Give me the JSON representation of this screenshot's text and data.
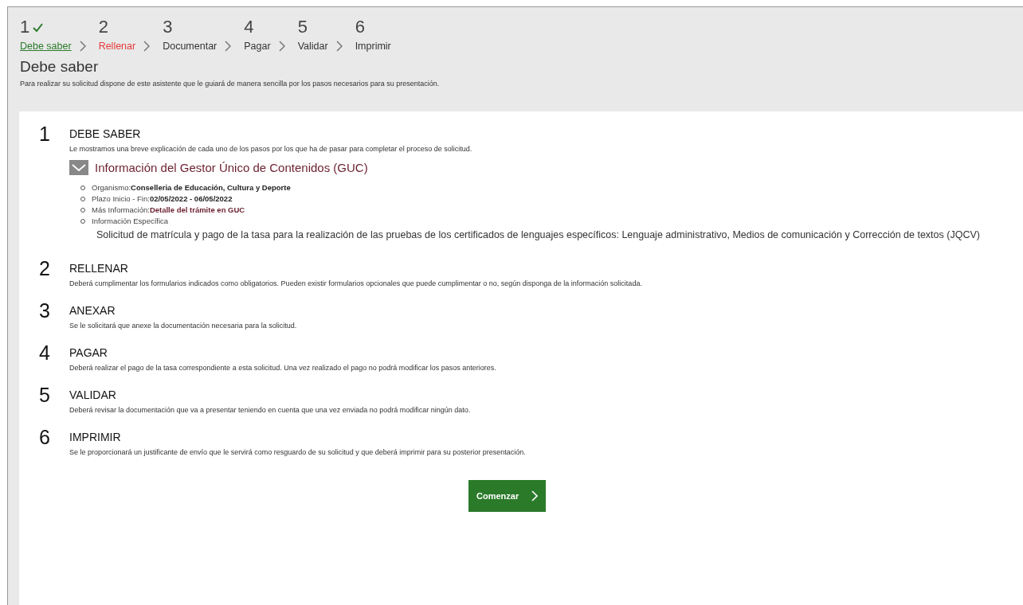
{
  "wizard": {
    "steps": [
      {
        "number": "1",
        "label": "Debe saber",
        "done": true,
        "selected": false
      },
      {
        "number": "2",
        "label": "Rellenar",
        "done": false,
        "selected": true
      },
      {
        "number": "3",
        "label": "Documentar",
        "done": false,
        "selected": false
      },
      {
        "number": "4",
        "label": "Pagar",
        "done": false,
        "selected": false
      },
      {
        "number": "5",
        "label": "Validar",
        "done": false,
        "selected": false
      },
      {
        "number": "6",
        "label": "Imprimir",
        "done": false,
        "selected": false
      }
    ]
  },
  "page": {
    "title": "Debe saber",
    "subtitle": "Para realizar su solicitud dispone de este asistente que le guiará de manera sencilla por los pasos necesarios para su presentación."
  },
  "sections": [
    {
      "number": "1",
      "title": "DEBE SABER",
      "description": "Le mostramos una breve explicación de cada uno de los pasos por los que ha de pasar para completar el proceso de solicitud.",
      "info": {
        "title": "Información del Gestor Único de Contenidos (GUC)",
        "expanded": true,
        "items": [
          {
            "label": "Organismo:",
            "value": "Conselleria de Educación, Cultura y Deporte",
            "kind": "text"
          },
          {
            "label": "Plazo Inicio - Fin:",
            "value": "02/05/2022 - 06/05/2022",
            "kind": "text"
          },
          {
            "label": "Más Información:",
            "value": "Detalle del trámite en GUC",
            "kind": "link"
          },
          {
            "label": "Información Específica",
            "kind": "text"
          }
        ],
        "detail": "Solicitud de matrícula y pago de la tasa para la realización de las pruebas de los certificados de lenguajes específicos: Lenguaje administrativo, Medios de comunicación y Corrección de textos (JQCV)"
      }
    },
    {
      "number": "2",
      "title": "RELLENAR",
      "description": "Deberá cumplimentar los formularios indicados como obligatorios. Pueden existir formularios opcionales que puede cumplimentar o no, según disponga de la información solicitada."
    },
    {
      "number": "3",
      "title": "ANEXAR",
      "description": "Se le solicitará que anexe la documentación necesaria para la solicitud."
    },
    {
      "number": "4",
      "title": "PAGAR",
      "description": "Deberá realizar el pago de la tasa correspondiente a esta solicitud. Una vez realizado el pago no podrá modificar los pasos anteriores."
    },
    {
      "number": "5",
      "title": "VALIDAR",
      "description": "Deberá revisar la documentación que va a presentar teniendo en cuenta que una vez enviada no podrá modificar ningún dato."
    },
    {
      "number": "6",
      "title": "IMPRIMIR",
      "description": "Se le proporcionará un justificante de envío que le servirá como resguardo de su solicitud y que deberá imprimir para su posterior presentación."
    }
  ],
  "start_button": {
    "label": "Comenzar"
  }
}
